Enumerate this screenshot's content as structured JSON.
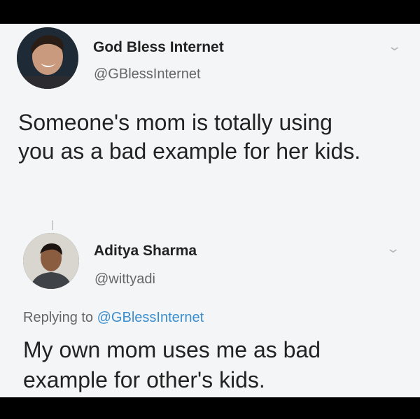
{
  "tweet": {
    "author_name": "God Bless Internet",
    "author_handle": "@GBlessInternet",
    "text_line1": "Someone's mom is totally using",
    "text_line2": "you as a bad example for her kids.",
    "menu_icon": "chevron-down-icon"
  },
  "reply": {
    "author_name": "Aditya Sharma",
    "author_handle": "@wittyadi",
    "replying_prefix": "Replying to",
    "replying_handle": "@GBlessInternet",
    "text_line1": "My own mom uses me as bad",
    "text_line2": "example for other's kids.",
    "menu_icon": "chevron-down-icon"
  },
  "colors": {
    "background": "#f4f5f6",
    "text": "#222222",
    "secondary": "#666666",
    "link": "#3a8ecf"
  }
}
